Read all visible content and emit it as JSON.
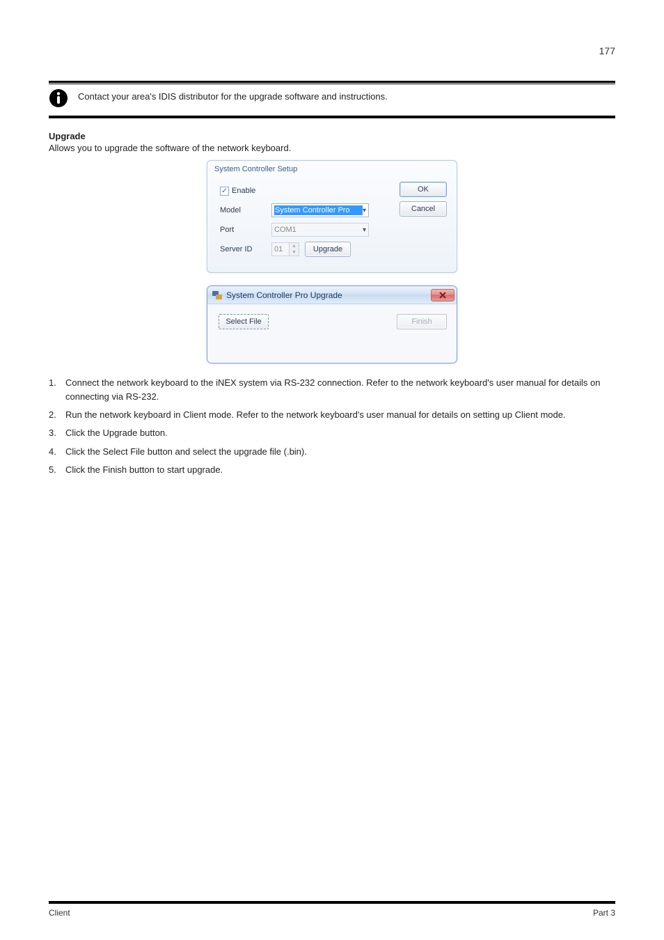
{
  "page": {
    "top_number": "177",
    "note": "Contact your area's IDIS distributor for the upgrade software and instructions.",
    "upgrade_heading": "Upgrade",
    "upgrade_intro": "Allows you to upgrade the software of the network keyboard."
  },
  "dialog1": {
    "title": "System Controller Setup",
    "enable_label": "Enable",
    "enable_checked": true,
    "model_label": "Model",
    "model_value": "System Controller Pro",
    "port_label": "Port",
    "port_value": "COM1",
    "serverid_label": "Server ID",
    "serverid_value": "01",
    "upgrade_btn": "Upgrade",
    "ok_btn": "OK",
    "cancel_btn": "Cancel"
  },
  "dialog2": {
    "title": "System Controller Pro Upgrade",
    "select_file_btn": "Select File",
    "finish_btn": "Finish"
  },
  "steps": [
    {
      "num": "1.",
      "text": "Connect the network keyboard to the iNEX system via RS-232 connection. Refer to the network keyboard's user manual for details on connecting via RS-232."
    },
    {
      "num": "2.",
      "text": "Run the network keyboard in Client mode. Refer to the network keyboard's user manual for details on setting up Client mode."
    },
    {
      "num": "3.",
      "text": "Click the Upgrade button."
    },
    {
      "num": "4.",
      "text": "Click the Select File button and select the upgrade file (.bin)."
    },
    {
      "num": "5.",
      "text": "Click the Finish button to start upgrade."
    }
  ],
  "footer": {
    "left": "Client",
    "right": "Part 3"
  }
}
